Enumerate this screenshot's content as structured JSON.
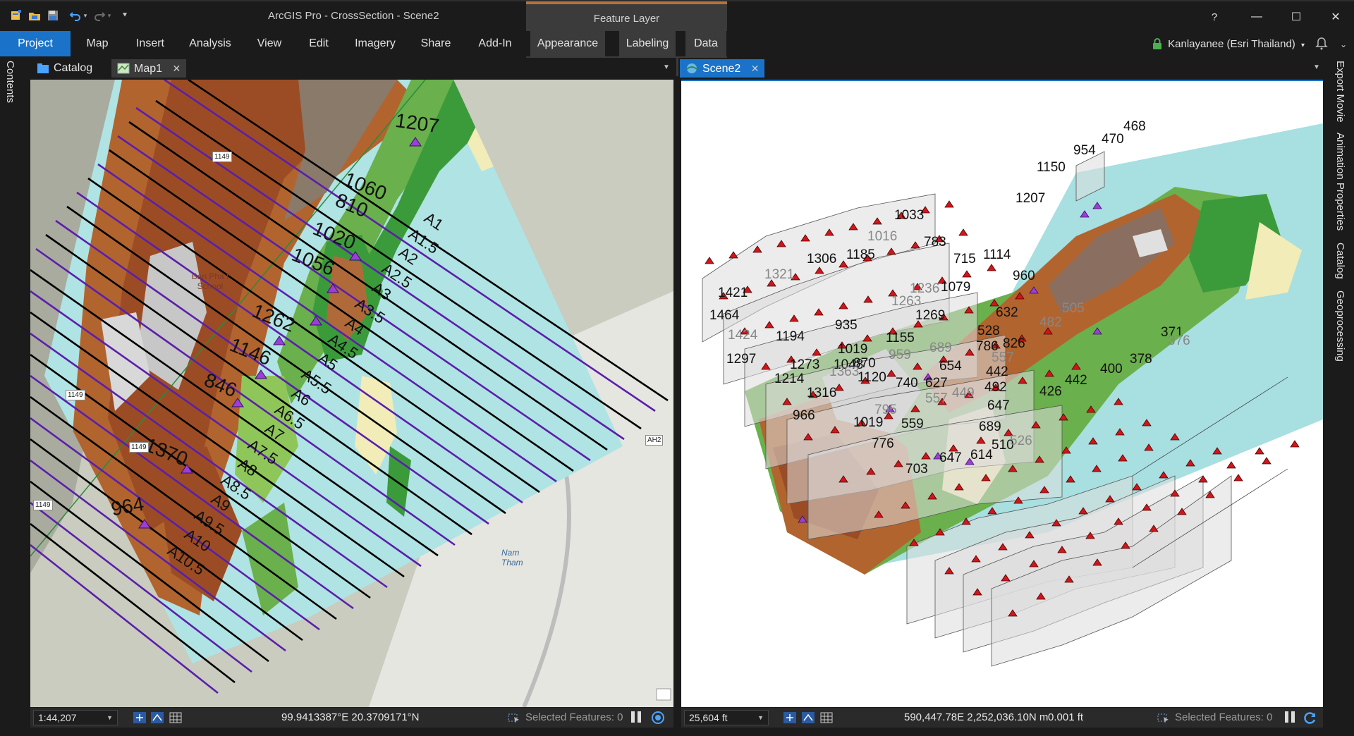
{
  "app": {
    "title": "ArcGIS Pro - CrossSection - Scene2",
    "context_header": "Feature Layer",
    "window_controls": {
      "help": "?",
      "minimize": "—",
      "maximize": "☐",
      "close": "✕"
    }
  },
  "quick_access": [
    "new-project-icon",
    "open-project-icon",
    "save-icon",
    "undo-icon",
    "redo-icon",
    "customize-icon"
  ],
  "ribbon": {
    "tabs": [
      {
        "label": "Project",
        "active": true
      },
      {
        "label": "Map"
      },
      {
        "label": "Insert"
      },
      {
        "label": "Analysis"
      },
      {
        "label": "View"
      },
      {
        "label": "Edit"
      },
      {
        "label": "Imagery"
      },
      {
        "label": "Share"
      },
      {
        "label": "Add-In"
      },
      {
        "label": "Appearance"
      },
      {
        "label": "Labeling"
      },
      {
        "label": "Data"
      }
    ],
    "user": "Kanlayanee (Esri Thailand)",
    "user_dropdown": "▾"
  },
  "left_panel": {
    "contents": "Contents"
  },
  "right_panel": {
    "tabs": [
      "Export Movie",
      "Animation Properties",
      "Catalog",
      "Geoprocessing"
    ]
  },
  "left_tabs": [
    {
      "label": "Catalog",
      "close": ""
    },
    {
      "label": "Map1",
      "close": "✕"
    }
  ],
  "right_tabs": [
    {
      "label": "Scene2",
      "close": "✕"
    }
  ],
  "map_view": {
    "peak_labels": [
      "1207",
      "1060",
      "810",
      "1020",
      "1056",
      "1262",
      "1146",
      "846",
      "1370",
      "964"
    ],
    "section_labels": [
      "A1",
      "A1.5",
      "A2",
      "A2.5",
      "A3",
      "A3.5",
      "A4",
      "A4.5",
      "A5",
      "A5.5",
      "A6",
      "A6.5",
      "A7",
      "A7.5",
      "A8",
      "A8.5",
      "A9",
      "A9.5",
      "A10",
      "A10.5"
    ],
    "road_shields": [
      "1149",
      "1149",
      "1149",
      "1149",
      "AH2"
    ],
    "place_labels": [
      "Ban Pha I School",
      "Nam Tham"
    ],
    "status": {
      "scale": "1:44,207",
      "coords": "99.9413387°E 20.3709171°N",
      "selected": "Selected Features: 0"
    }
  },
  "scene_view": {
    "labels_black": [
      "468",
      "470",
      "954",
      "1150",
      "1207",
      "1033",
      "783",
      "715",
      "1114",
      "1306",
      "1185",
      "1421",
      "1464",
      "1079",
      "960",
      "632",
      "1269",
      "935",
      "528",
      "826",
      "786",
      "1194",
      "1019",
      "1155",
      "1297",
      "1273",
      "1048",
      "870",
      "654",
      "442",
      "1214",
      "1120",
      "740",
      "627",
      "492",
      "1316",
      "647",
      "966",
      "1019",
      "559",
      "689",
      "510",
      "776",
      "614",
      "703",
      "647",
      "371",
      "378",
      "442",
      "400",
      "426"
    ],
    "labels_grey": [
      "1016",
      "1321",
      "1236",
      "1263",
      "1424",
      "505",
      "482",
      "689",
      "959",
      "557",
      "1363",
      "449",
      "557",
      "795",
      "526",
      "376"
    ],
    "status": {
      "scale": "25,604 ft",
      "coords": "590,447.78E 2,252,036.10N m",
      "elev": "0.001 ft",
      "selected": "Selected Features: 0"
    }
  },
  "colors": {
    "accent": "#1a73c9",
    "context": "#b2743a",
    "ribbon_bg": "#1b1b1b",
    "water": "#a8dfe0",
    "section_black": "#000000",
    "section_purple": "#5a1faa"
  }
}
